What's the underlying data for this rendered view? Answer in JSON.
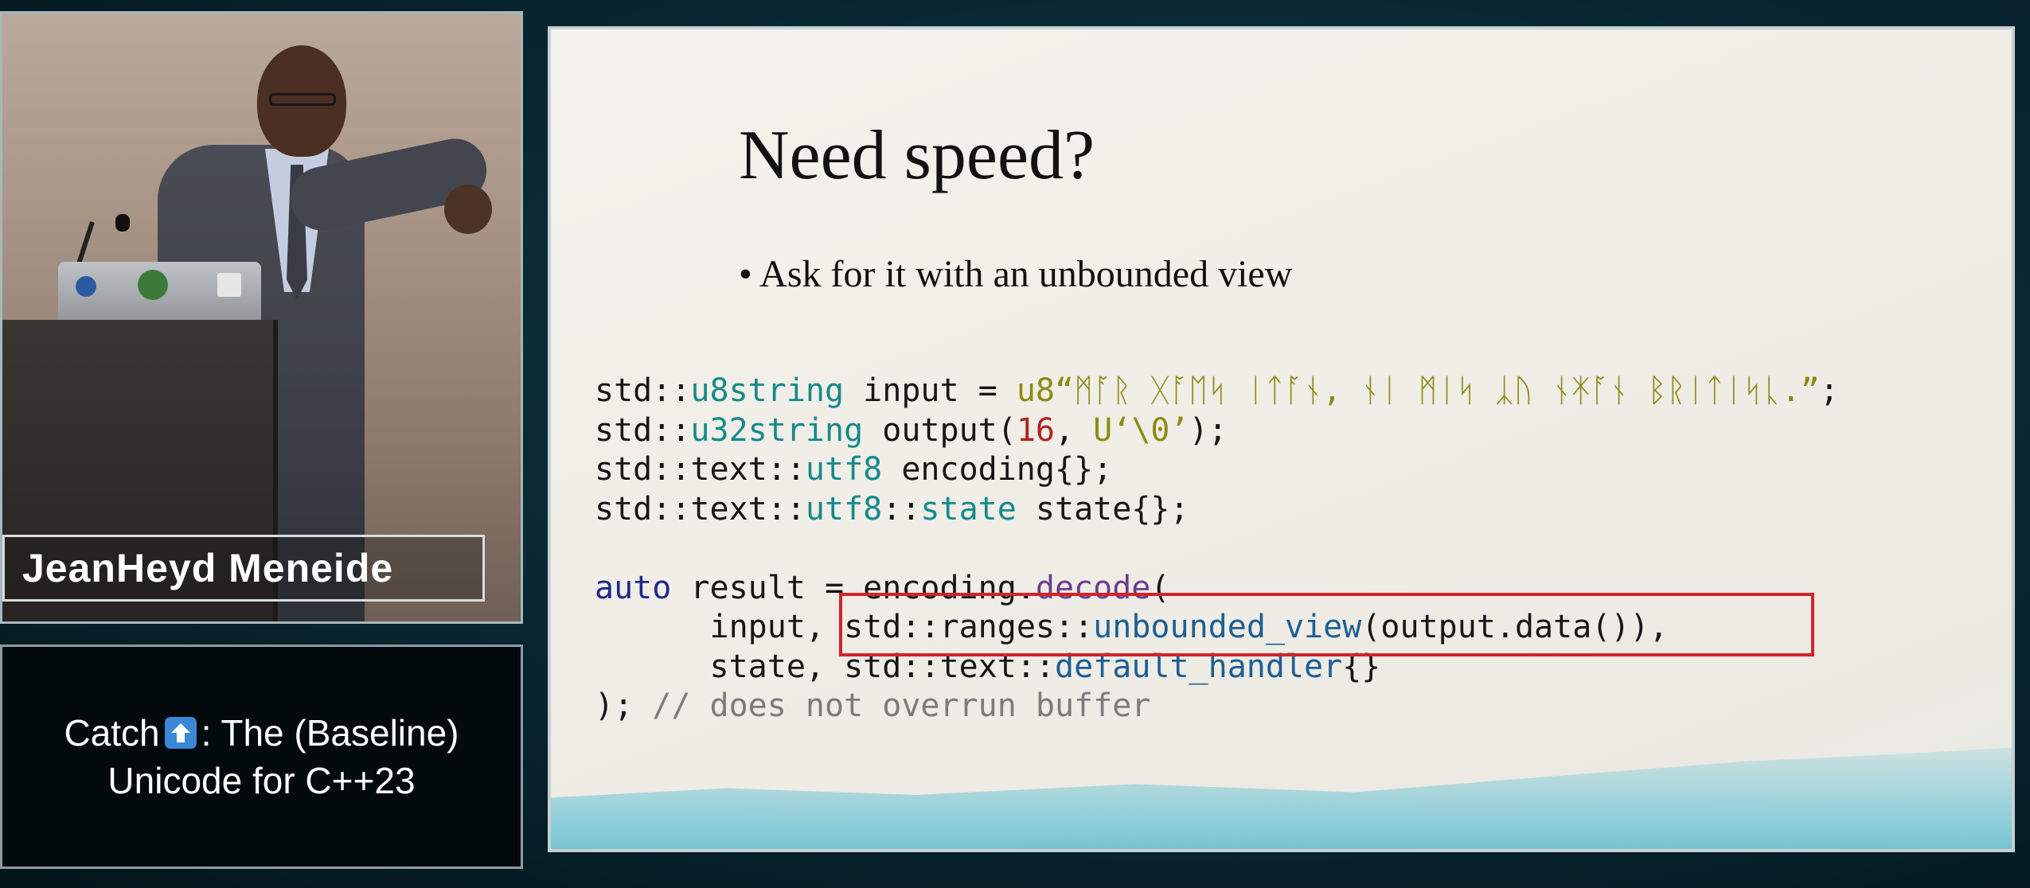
{
  "speaker": {
    "name": "JeanHeyd Meneide"
  },
  "talk": {
    "title_before_icon": "Catch ",
    "title_after_icon": ": The (Baseline)",
    "title_line2": "Unicode for C++23",
    "icon": "up-arrow-icon",
    "icon_color": "#3a87d6"
  },
  "slide": {
    "title": "Need speed?",
    "bullet": "• Ask for it with an unbounded view",
    "code": {
      "l1_ns": "std::",
      "l1_type": "u8string",
      "l1_mid": " input = ",
      "l1_str": "u8“ᛗᚪᚱ ᚷᚪᛖᛋ ᛁᛏᚪᚾ, ᚾᛁ ᛗᛁᛋ ᛣᚢ ᚾᛡᚪᚾ ᛒᚱᛁᛏᛁᛋᚳ.”",
      "l1_end": ";",
      "l2_ns": "std::",
      "l2_type": "u32string",
      "l2_mid": " output(",
      "l2_num": "16",
      "l2_sep": ", ",
      "l2_str": "U‘\\0’",
      "l2_end": ");",
      "l3_ns": "std::text::",
      "l3_type": "utf8",
      "l3_end": " encoding{};",
      "l4_ns": "std::text::",
      "l4_type": "utf8",
      "l4_sep": "::",
      "l4_type2": "state",
      "l4_end": " state{};",
      "l6_kw": "auto",
      "l6_mid": " result = encoding.",
      "l6_fn": "decode",
      "l6_end": "(",
      "l7_pre": "      input, ",
      "l7_ns": "std::ranges::",
      "l7_fn": "unbounded_view",
      "l7_end": "(output.data()),",
      "l8_pre": "      state, ",
      "l8_ns": "std::text::",
      "l8_fn": "default_handler",
      "l8_end": "{}",
      "l9_pre": "); ",
      "l9_cmt": "// does not overrun buffer"
    },
    "highlight_color": "#d2232a"
  }
}
